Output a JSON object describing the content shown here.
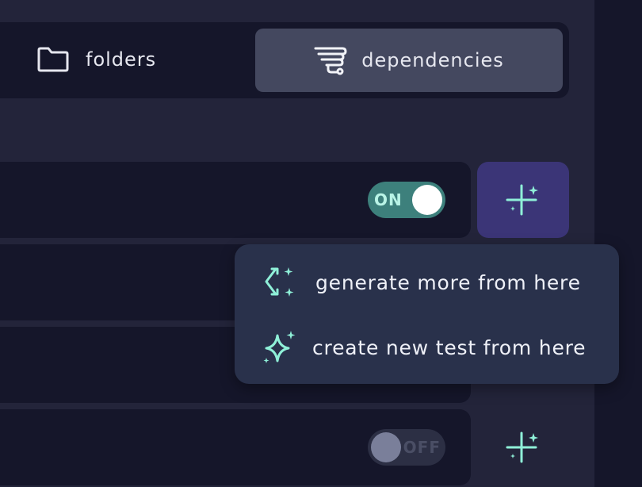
{
  "tabs": [
    {
      "label": "folders",
      "icon": "folder-icon",
      "active": false
    },
    {
      "label": "dependencies",
      "icon": "dependencies-icon",
      "active": true
    }
  ],
  "rows": [
    {
      "toggle": "ON",
      "toggle_state": true
    },
    {
      "toggle": "OFF",
      "toggle_state": false
    }
  ],
  "menu": {
    "generate_label": "generate more from here",
    "create_label": "create new test from here"
  },
  "colors": {
    "background": "#23243a",
    "panel": "#15162a",
    "active_tab": "#44485f",
    "toggle_on": "#3d807c",
    "accent_button": "#3b3577",
    "accent_icon": "#8ff0d8",
    "popup": "#29314b"
  }
}
